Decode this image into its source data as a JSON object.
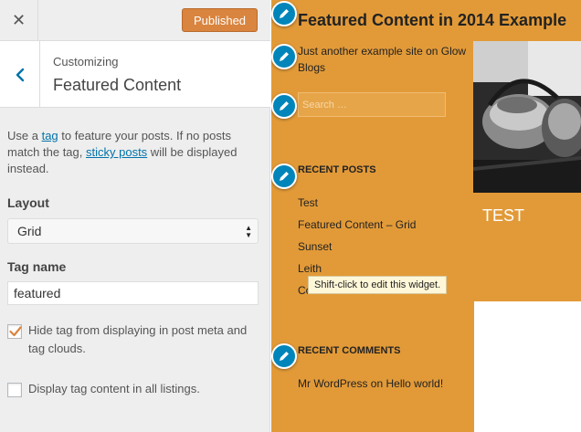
{
  "topbar": {
    "close_icon": "close-icon",
    "publish_label": "Published"
  },
  "section": {
    "back_icon": "chevron-left-icon",
    "customizing_label": "Customizing",
    "title": "Featured Content"
  },
  "description": {
    "part1": "Use a ",
    "tag_link": "tag",
    "part2": " to feature your posts. If no posts match the tag, ",
    "sticky_link": "sticky posts",
    "part3": " will be displayed instead."
  },
  "layout": {
    "label": "Layout",
    "selected": "Grid"
  },
  "tag_name": {
    "label": "Tag name",
    "value": "featured"
  },
  "checkboxes": [
    {
      "label": "Hide tag from displaying in post meta and tag clouds.",
      "checked": true
    },
    {
      "label": "Display tag content in all listings.",
      "checked": false
    }
  ],
  "preview": {
    "site_title": "Featured Content in 2014 Example",
    "site_description": "Just another example site on Glow Blogs",
    "search_placeholder": "Search …",
    "recent_posts": {
      "title": "Recent Posts",
      "items": [
        "Test",
        "Featured Content – Grid",
        "Sunset",
        "Leith",
        "Co"
      ]
    },
    "recent_comments": {
      "title": "Recent Comments",
      "author": "Mr WordPress",
      "on": "on",
      "post": "Hello world!"
    },
    "tooltip": "Shift-click to edit this widget.",
    "featured_caption": "TEST",
    "edit_icon": "pencil-icon",
    "accent_color": "#e29a38",
    "shortcut_color": "#0085ba"
  },
  "colors": {
    "publish_button": "#d9843f",
    "link": "#0073aa",
    "check": "#d9843f"
  }
}
